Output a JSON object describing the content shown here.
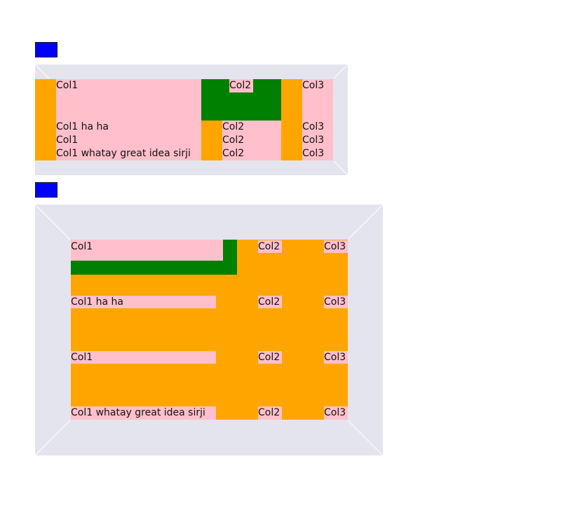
{
  "table1": {
    "header": {
      "c1": "Col1",
      "c2": "Col2",
      "c3": "Col3"
    },
    "rows": [
      {
        "c1": "Col1 ha ha",
        "c2": "Col2",
        "c3": "Col3"
      },
      {
        "c1": "Col1",
        "c2": "Col2",
        "c3": "Col3"
      },
      {
        "c1": "Col1 whatay great idea sirji",
        "c2": "Col2",
        "c3": "Col3"
      }
    ]
  },
  "table2": {
    "header": {
      "c1": "Col1",
      "c2": "Col2",
      "c3": "Col3"
    },
    "rows": [
      {
        "c1": "Col1 ha ha",
        "c2": "Col2",
        "c3": "Col3"
      },
      {
        "c1": "Col1",
        "c2": "Col2",
        "c3": "Col3"
      },
      {
        "c1": "Col1 whatay great idea sirji",
        "c2": "Col2",
        "c3": "Col3"
      }
    ]
  },
  "colors": {
    "blue": "#0000ff",
    "frame": "#e4e4ee",
    "orange": "#ffa500",
    "pink": "#ffc0cb",
    "green": "#008000"
  }
}
